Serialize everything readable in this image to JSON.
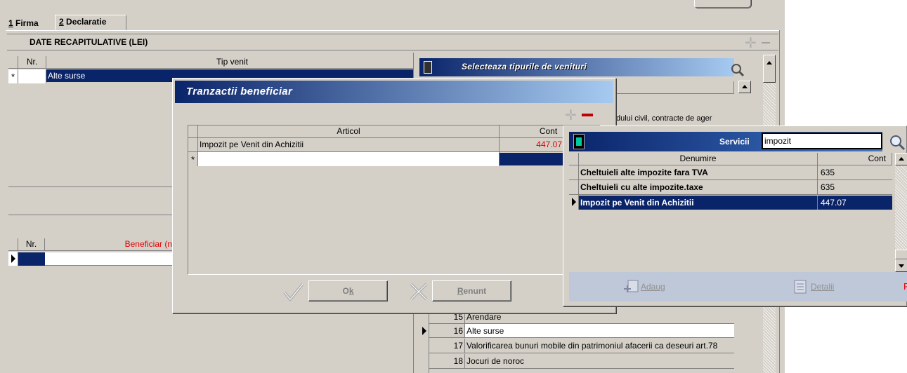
{
  "tabs": [
    {
      "hotkey": "1",
      "label": " Firma"
    },
    {
      "hotkey": "2",
      "label": " Declaratie"
    }
  ],
  "section": {
    "title": "DATE RECAPITULATIVE (LEI)"
  },
  "venit_grid": {
    "columns": [
      "Nr.",
      "Tip venit"
    ],
    "new_row_marker": "*",
    "rows": [
      {
        "nr": "",
        "tip": "Alte surse"
      }
    ]
  },
  "beneficiar_grid": {
    "columns": [
      "Nr.",
      "Beneficiar (n"
    ]
  },
  "tipuri_panel": {
    "title": "Selecteaza tipurile de venituri",
    "header_fragment": "t",
    "row_fragment": "dului civil, contracte de ager",
    "rows": [
      {
        "nr": "15",
        "label": "Arendare"
      },
      {
        "nr": "16",
        "label": "Alte surse",
        "current": true
      },
      {
        "nr": "17",
        "label": "Valorificarea bunuri mobile din patrimoniul afacerii ca deseuri art.78"
      },
      {
        "nr": "18",
        "label": "Jocuri de noroc"
      }
    ]
  },
  "tranzactii_dialog": {
    "title": "Tranzactii beneficiar",
    "columns": [
      "Articol",
      "Cont"
    ],
    "rows": [
      {
        "articol": "Impozit pe Venit din Achizitii",
        "cont": "447.07"
      }
    ],
    "new_row_marker": "*",
    "ok_label": "Ok",
    "ok_hotkey": "k",
    "cancel_label": "Renunt",
    "cancel_hotkey": "R"
  },
  "servicii_popup": {
    "label": "Servicii",
    "search_value": "impozit",
    "columns": [
      "Denumire",
      "Cont"
    ],
    "rows": [
      {
        "denumire": "Cheltuieli alte impozite fara TVA",
        "cont": "635"
      },
      {
        "denumire": "Cheltuieli cu alte impozite.taxe",
        "cont": "635"
      },
      {
        "denumire": "Impozit pe Venit din Achizitii",
        "cont": "447.07",
        "selected": true
      }
    ],
    "add_label": "Adaug",
    "details_label": "Detalii",
    "trailing_letter": "R"
  },
  "colors": {
    "selection": "#0a246a",
    "face": "#d4d0c8",
    "cont_red": "#e00000"
  }
}
